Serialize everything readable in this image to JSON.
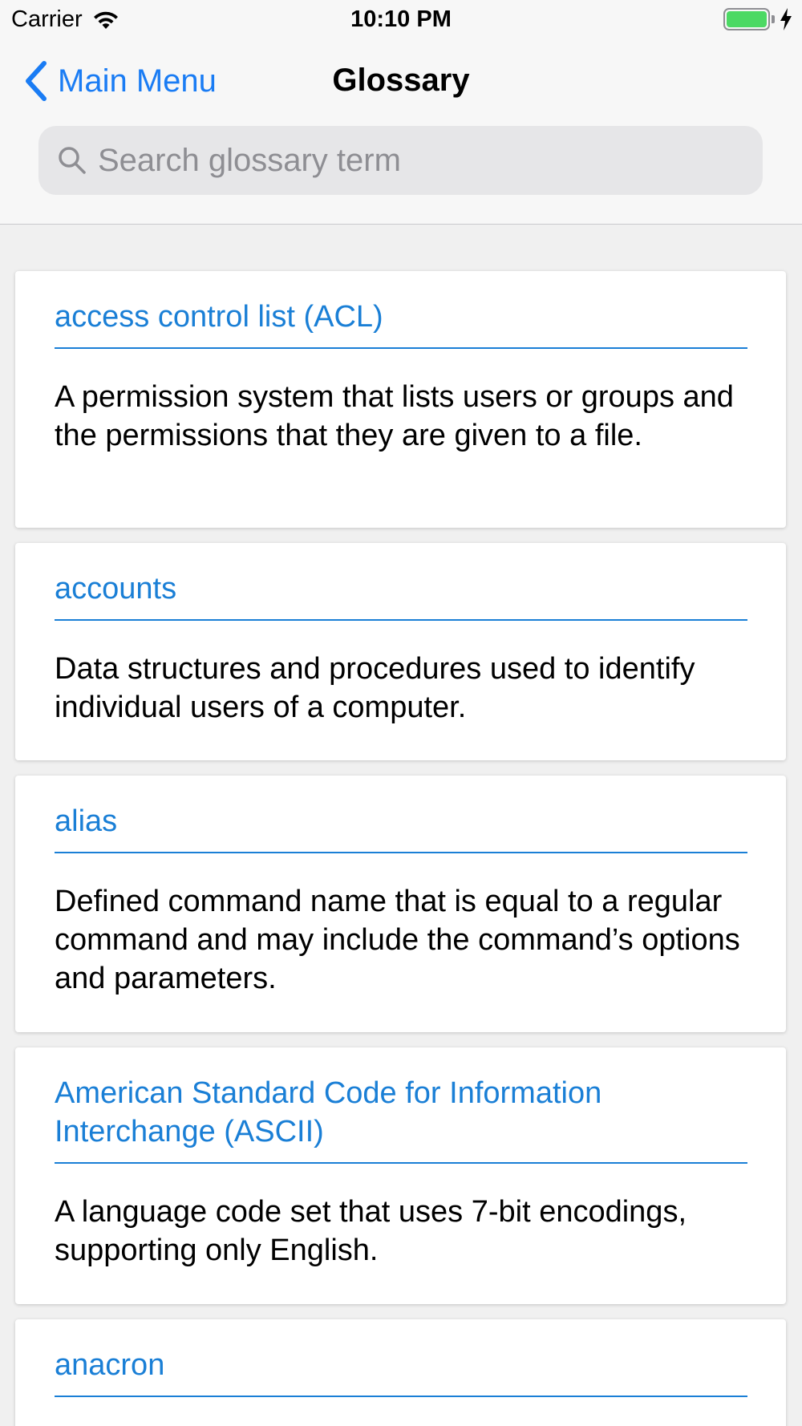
{
  "status_bar": {
    "carrier": "Carrier",
    "time": "10:10 PM",
    "battery_level": 1.0,
    "battery_color": "#4cd964"
  },
  "nav": {
    "back_label": "Main Menu",
    "title": "Glossary",
    "accent_color": "#1a7cf4"
  },
  "search": {
    "placeholder": "Search glossary term",
    "value": ""
  },
  "glossary": {
    "term_color": "#1a7fd6",
    "entries": [
      {
        "term": "access control list (ACL)",
        "definition": "A permission system that lists users or groups and the permissions that they are given to a file."
      },
      {
        "term": "accounts",
        "definition": "Data structures and procedures used to identify individual users of a computer."
      },
      {
        "term": "alias",
        "definition": "Defined command name that is equal to a regular command and may include the command’s options and parameters."
      },
      {
        "term": "American Standard Code for Information Interchange (ASCII)",
        "definition": "A language code set that uses 7-bit encodings, supporting only English."
      },
      {
        "term": "anacron",
        "definition": ""
      }
    ]
  }
}
